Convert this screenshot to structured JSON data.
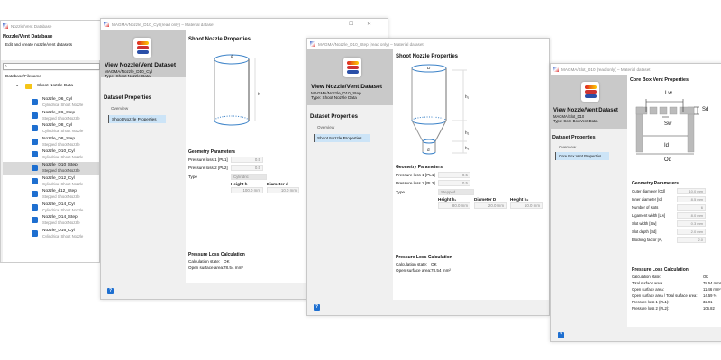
{
  "left_panel": {
    "window_title": "Nozzle/Vent Database",
    "heading": "Nozzle/Vent Database",
    "description": "Edit and create nozzle/vent datasets",
    "search_placeholder": "",
    "column_header": "Database/Filename",
    "folder": "Shoot Nozzle Data",
    "items": [
      {
        "name": "Nozzle_D6_Cyl",
        "type": "Cylindrical Shoot Nozzle"
      },
      {
        "name": "Nozzle_D6_Step",
        "type": "Stepped Shoot Nozzle"
      },
      {
        "name": "Nozzle_D8_Cyl",
        "type": "Cylindrical Shoot Nozzle"
      },
      {
        "name": "Nozzle_D8_Step",
        "type": "Stepped Shoot Nozzle"
      },
      {
        "name": "Nozzle_D10_Cyl",
        "type": "Cylindrical Shoot Nozzle"
      },
      {
        "name": "Nozzle_D10_Step",
        "type": "Stepped Shoot Nozzle",
        "selected": true
      },
      {
        "name": "Nozzle_D12_Cyl",
        "type": "Cylindrical Shoot Nozzle"
      },
      {
        "name": "Nozzle_d12_Step",
        "type": "Stepped Shoot Nozzle"
      },
      {
        "name": "Nozzle_D14_Cyl",
        "type": "Cylindrical Shoot Nozzle"
      },
      {
        "name": "Nozzle_D14_Step",
        "type": "Stepped Shoot Nozzle"
      },
      {
        "name": "Nozzle_D16_Cyl",
        "type": "Cylindrical Shoot Nozzle"
      }
    ]
  },
  "common": {
    "view_title": "View Nozzle/Vent Dataset",
    "dataset_properties": "Dataset Properties",
    "overview": "Overview",
    "geometry_parameters": "Geometry Parameters",
    "pressure_loss_calc": "Pressure Loss Calculation",
    "calc_state_label": "Calculation state:",
    "open_surface_label": "Open surface area:",
    "pl1_label": "Pressure loss 1 [PL1]",
    "pl2_label": "Pressure loss 2 [PL2]",
    "type_label": "Type",
    "help": "?",
    "minimize": "–",
    "maximize": "☐",
    "close": "✕"
  },
  "win_cyl": {
    "title": "MAGMA/Nozzle_D10_Cyl (read only) – Material dataset",
    "path": "MAGMA/Nozzle_D10_Cyl",
    "type": "Type: Shoot Nozzle Data",
    "nav_selected": "Shoot Nozzle Properties",
    "page_title": "Shoot Nozzle Properties",
    "diagram": {
      "d": "d",
      "h": "h"
    },
    "pl1": "0.5",
    "pl2": "0.5",
    "type_value": "Cylindric",
    "height_label": "Height h",
    "height_value": "100.0 mm",
    "diameter_label": "Diameter d",
    "diameter_value": "10.0 mm",
    "calc_state": "OK",
    "open_surface": "78.54 mm²"
  },
  "win_step": {
    "title": "MAGMA/Nozzle_D10_Step (read only) – Material dataset",
    "path": "MAGMA/Nozzle_D10_Step",
    "type": "Type: Shoot Nozzle Data",
    "nav_selected": "Shoot Nozzle Properties",
    "page_title": "Shoot Nozzle Properties",
    "diagram": {
      "D": "D",
      "d": "d",
      "h1": "h₁",
      "h2": "h₂",
      "h3": "h₃"
    },
    "pl1": "0.5",
    "pl2": "0.5",
    "type_value": "Stepped",
    "height1_label": "Height h₁",
    "height1_value": "80.0 mm",
    "diameter_label": "Diameter D",
    "diameter_value": "20.0 mm",
    "height2_label": "Height h₂",
    "height2_value": "10.0 mm",
    "calc_state": "OK",
    "open_surface": "78.54 mm²"
  },
  "win_vent": {
    "title": "MAGMA/Slot_D10 (read only) – Material dataset",
    "path": "MAGMA/Slot_D10",
    "type": "Type: Core Box Vent Data",
    "nav_selected": "Core Box Vent Properties",
    "page_title": "Core Box Vent Properties",
    "diagram": {
      "Lw": "Lw",
      "Sd": "Sd",
      "Sw": "Sw",
      "Id": "Id",
      "Od": "Od"
    },
    "params": [
      {
        "label": "Outer diameter [Od]",
        "value": "10.0 mm"
      },
      {
        "label": "Inner diameter [Id]",
        "value": "8.5 mm"
      },
      {
        "label": "Number of slots",
        "value": "6"
      },
      {
        "label": "Ligament width [Lw]",
        "value": "8.0 mm"
      },
      {
        "label": "Slot width [Sw]",
        "value": "0.3 mm"
      },
      {
        "label": "Slot depth [Sd]",
        "value": "2.0 mm"
      },
      {
        "label": "Blocking factor [A]",
        "value": "2.0"
      }
    ],
    "results": [
      {
        "label": "Calculation state:",
        "value": "OK"
      },
      {
        "label": "Total surface area:",
        "value": "78.54 mm²"
      },
      {
        "label": "Open surface area:",
        "value": "11.46 mm²"
      },
      {
        "label": "Open surface area / Total surface area:",
        "value": "14.59 %"
      },
      {
        "label": "Pressure loss 1 (PL1):",
        "value": "32.91"
      },
      {
        "label": "Pressure loss 2 (PL2):",
        "value": "106.82"
      }
    ]
  },
  "colors": {
    "accent": "#1e6fd0",
    "selection": "#cce4f7",
    "header": "#c9c9c9",
    "diagram": "#3b82c8"
  }
}
